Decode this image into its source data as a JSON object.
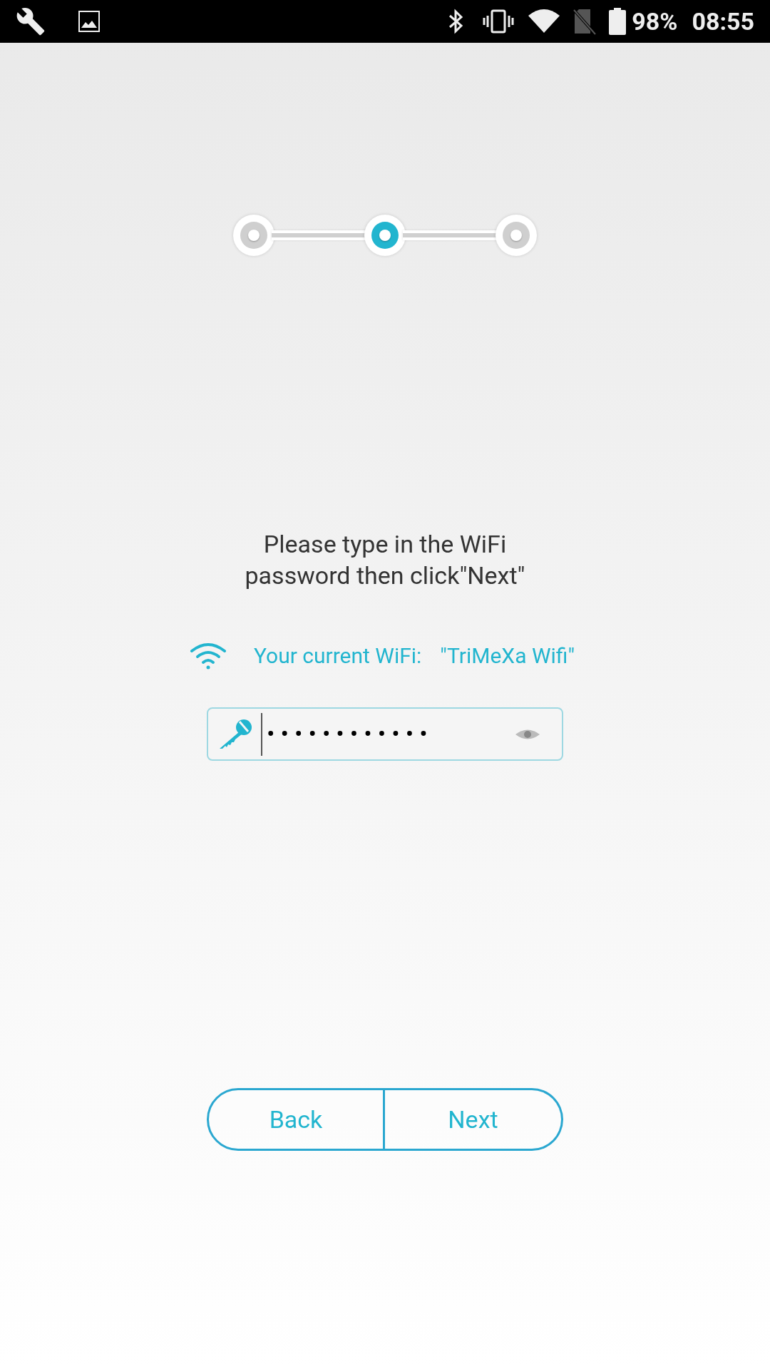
{
  "status_bar": {
    "battery": "98%",
    "time": "08:55"
  },
  "steps": [
    {
      "selected": false
    },
    {
      "selected": true
    },
    {
      "selected": false
    }
  ],
  "instruction": "Please type in the WiFi password then click\"Next\"",
  "wifi": {
    "label": "Your current WiFi:",
    "network": "\"TriMeXa Wifi\""
  },
  "password_field": {
    "value": "••••••••••••"
  },
  "buttons": [
    {
      "label": "Back"
    },
    {
      "label": "Next"
    }
  ]
}
